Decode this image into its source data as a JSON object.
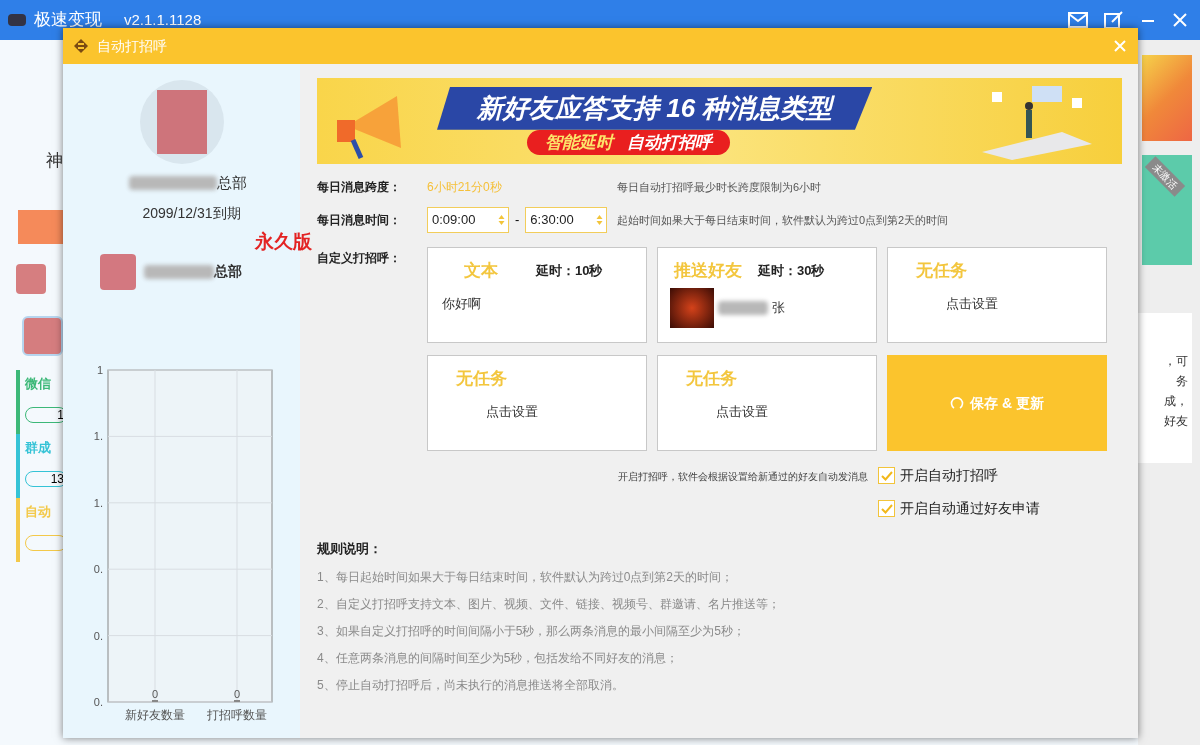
{
  "background_window": {
    "title": "极速变现",
    "version": "v2.1.1.1128",
    "side_label": "神",
    "sections": [
      {
        "label": "微信",
        "value": "1",
        "color": "#3cb878"
      },
      {
        "label": "群成",
        "value": "13",
        "color": "#35c3d6"
      },
      {
        "label": "自动",
        "color": "#f3c94a"
      }
    ],
    "badge": "未激活",
    "right_fragments": [
      "，可",
      "务",
      "成，",
      "好友"
    ]
  },
  "dialog": {
    "title": "自动打招呼",
    "account": {
      "name_suffix": "总部",
      "expiry": "2099/12/31到期",
      "edition": "永久版"
    },
    "sub_account": {
      "name_suffix": "总部"
    },
    "chart_data": {
      "type": "bar",
      "grid": true,
      "categories": [
        "新好友数量",
        "打招呼数量"
      ],
      "values": [
        0,
        0
      ],
      "ylim": [
        0,
        1
      ],
      "data_labels": true,
      "yticks": [
        {
          "value": 0,
          "label": "0."
        },
        {
          "value": 0.2,
          "label": "0."
        },
        {
          "value": 0.4,
          "label": "0."
        },
        {
          "value": 0.6,
          "label": "1."
        },
        {
          "value": 0.8,
          "label": "1."
        },
        {
          "value": 1,
          "label": "1"
        }
      ]
    },
    "banner": {
      "headline": "新好友应答支持 16 种消息类型",
      "tags": [
        "智能延时",
        "自动打招呼"
      ]
    },
    "span": {
      "label": "每日消息跨度：",
      "value": "6小时21分0秒",
      "hint": "每日自动打招呼最少时长跨度限制为6小时"
    },
    "time": {
      "label": "每日消息时间：",
      "start": "0:09:00",
      "separator": "-",
      "end": "6:30:00",
      "hint": "起始时间如果大于每日结束时间，软件默认为跨过0点到第2天的时间"
    },
    "greeting": {
      "label": "自定义打招呼：",
      "save_button": "保存 & 更新",
      "cards": [
        {
          "kind": "text",
          "title": "文本",
          "delay": "延时：10秒",
          "content": "你好啊"
        },
        {
          "kind": "friend",
          "title": "推送好友",
          "delay": "延时：30秒",
          "name_suffix": "张"
        },
        {
          "kind": "empty",
          "title": "无任务",
          "content": "点击设置"
        },
        {
          "kind": "empty",
          "title": "无任务",
          "content": "点击设置"
        },
        {
          "kind": "empty",
          "title": "无任务",
          "content": "点击设置"
        }
      ]
    },
    "auto_hint": "开启打招呼，软件会根据设置给新通过的好友自动发消息",
    "options": [
      {
        "label": "开启自动打招呼",
        "checked": true
      },
      {
        "label": "开启自动通过好友申请",
        "checked": true
      }
    ],
    "rules": {
      "title": "规则说明：",
      "items": [
        "1、每日起始时间如果大于每日结束时间，软件默认为跨过0点到第2天的时间；",
        "2、自定义打招呼支持文本、图片、视频、文件、链接、视频号、群邀请、名片推送等；",
        "3、如果自定义打招呼的时间间隔小于5秒，那么两条消息的最小间隔至少为5秒；",
        "4、任意两条消息的间隔时间至少为5秒，包括发给不同好友的消息；",
        "5、停止自动打招呼后，尚未执行的消息推送将全部取消。"
      ]
    }
  }
}
